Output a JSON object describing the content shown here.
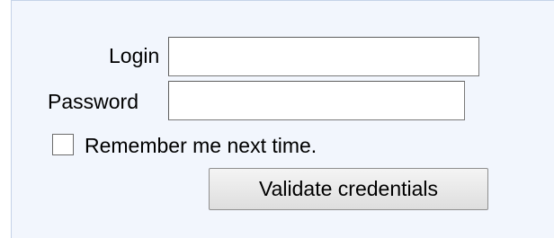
{
  "login_form": {
    "login_label": "Login",
    "login_value": "",
    "password_label": "Password",
    "password_value": "",
    "remember_checked": false,
    "remember_label": "Remember me next time.",
    "submit_label": "Validate credentials"
  },
  "colors": {
    "panel_background": "#f2f6fd",
    "panel_border": "#c5d3e8"
  }
}
